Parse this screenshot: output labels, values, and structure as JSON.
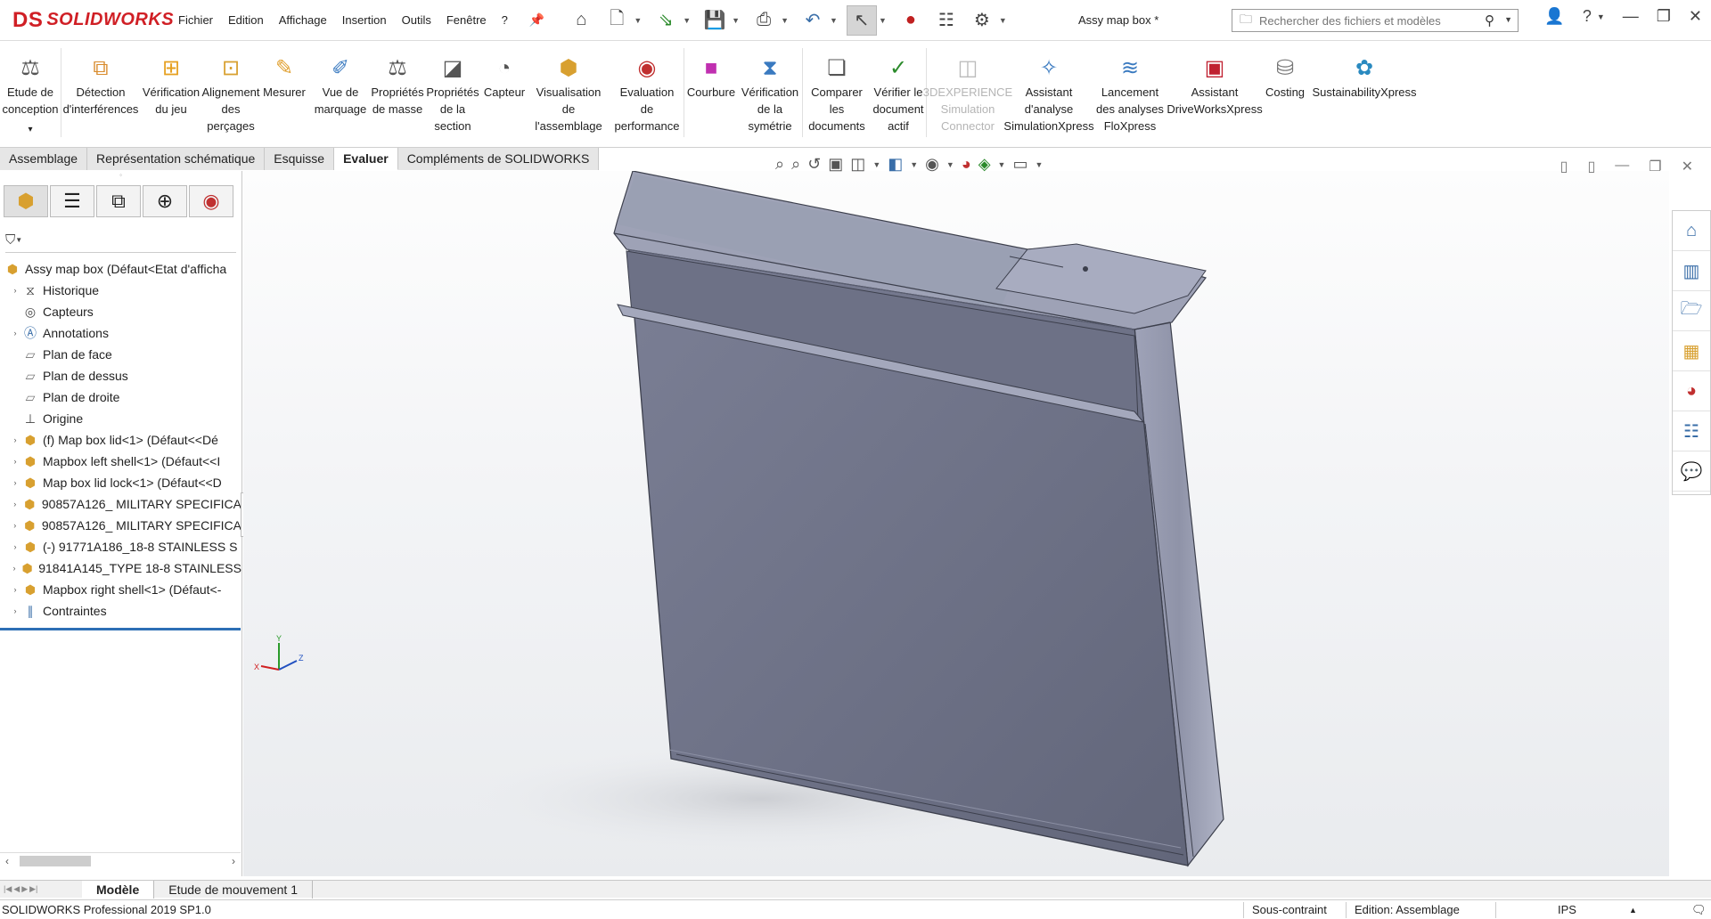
{
  "app": {
    "logo_mark": "DS",
    "logo_text": "SOLIDWORKS",
    "doc_title": "Assy map box *"
  },
  "menu": [
    "Fichier",
    "Edition",
    "Affichage",
    "Insertion",
    "Outils",
    "Fenêtre",
    "?"
  ],
  "search": {
    "placeholder": "Rechercher des fichiers et modèles"
  },
  "ribbon": [
    {
      "label": "Etude de\nconception",
      "icon": "design-study-icon",
      "color": "#555"
    },
    {
      "label": "Détection\nd'interférences",
      "icon": "interference-icon",
      "color": "#d88a2b"
    },
    {
      "label": "Vérification\ndu jeu",
      "icon": "clearance-icon",
      "color": "#e6a020"
    },
    {
      "label": "Alignement\ndes\nperçages",
      "icon": "hole-align-icon",
      "color": "#d8a030"
    },
    {
      "label": "Mesurer",
      "icon": "measure-icon",
      "color": "#e0a030"
    },
    {
      "label": "Vue de\nmarquage",
      "icon": "markup-icon",
      "color": "#3a7ac0"
    },
    {
      "label": "Propriétés\nde masse",
      "icon": "mass-props-icon",
      "color": "#555"
    },
    {
      "label": "Propriétés\nde la\nsection",
      "icon": "section-props-icon",
      "color": "#555"
    },
    {
      "label": "Capteur",
      "icon": "sensor-icon",
      "color": "#555"
    },
    {
      "label": "Visualisation\nde\nl'assemblage",
      "icon": "assembly-vis-icon",
      "color": "#d8a030"
    },
    {
      "label": "Evaluation\nde\nperformance",
      "icon": "performance-icon",
      "color": "#c03030"
    },
    {
      "label": "Courbure",
      "icon": "curvature-icon",
      "color": "#c02fb0"
    },
    {
      "label": "Vérification\nde la\nsymétrie",
      "icon": "symmetry-icon",
      "color": "#3a7ac0"
    },
    {
      "label": "Comparer\nles\ndocuments",
      "icon": "compare-icon",
      "color": "#555"
    },
    {
      "label": "Vérifier le\ndocument\nactif",
      "icon": "check-doc-icon",
      "color": "#2a8a2a"
    },
    {
      "label": "3DEXPERIENCE\nSimulation\nConnector",
      "icon": "3dx-icon",
      "color": "#bbb",
      "disabled": true
    },
    {
      "label": "Assistant\nd'analyse\nSimulationXpress",
      "icon": "simxpress-icon",
      "color": "#3a7ac0"
    },
    {
      "label": "Lancement\ndes analyses\nFloXpress",
      "icon": "floxpress-icon",
      "color": "#3a7ac0"
    },
    {
      "label": "Assistant\nDriveWorksXpress",
      "icon": "driveworks-icon",
      "color": "#c02030"
    },
    {
      "label": "Costing",
      "icon": "costing-icon",
      "color": "#777"
    },
    {
      "label": "SustainabilityXpress",
      "icon": "sustainability-icon",
      "color": "#2a8ac0"
    }
  ],
  "tabs": [
    "Assemblage",
    "Représentation schématique",
    "Esquisse",
    "Evaluer",
    "Compléments de SOLIDWORKS"
  ],
  "tree": {
    "root": "Assy map box  (Défaut<Etat d'afficha",
    "items": [
      {
        "label": "Historique",
        "expand": true,
        "icon": "history-icon"
      },
      {
        "label": "Capteurs",
        "expand": false,
        "icon": "sensors-icon"
      },
      {
        "label": "Annotations",
        "expand": true,
        "icon": "annotations-icon"
      },
      {
        "label": "Plan de face",
        "expand": false,
        "icon": "plane-icon"
      },
      {
        "label": "Plan de dessus",
        "expand": false,
        "icon": "plane-icon"
      },
      {
        "label": "Plan de droite",
        "expand": false,
        "icon": "plane-icon"
      },
      {
        "label": "Origine",
        "expand": false,
        "icon": "origin-icon"
      },
      {
        "label": "(f) Map box lid<1> (Défaut<<Dé",
        "expand": true,
        "icon": "part-icon"
      },
      {
        "label": "Mapbox left shell<1> (Défaut<<I",
        "expand": true,
        "icon": "part-icon"
      },
      {
        "label": "Map box lid lock<1> (Défaut<<D",
        "expand": true,
        "icon": "part-icon"
      },
      {
        "label": "90857A126_ MILITARY SPECIFICA",
        "expand": true,
        "icon": "part-icon"
      },
      {
        "label": "90857A126_ MILITARY SPECIFICA",
        "expand": true,
        "icon": "part-icon"
      },
      {
        "label": "(-) 91771A186_18-8 STAINLESS S",
        "expand": true,
        "icon": "part-icon"
      },
      {
        "label": "91841A145_TYPE 18-8 STAINLESS",
        "expand": true,
        "icon": "part-icon"
      },
      {
        "label": "Mapbox right shell<1> (Défaut<-",
        "expand": true,
        "icon": "part-icon"
      },
      {
        "label": "Contraintes",
        "expand": true,
        "icon": "mates-icon"
      }
    ]
  },
  "bottom_tabs": [
    "Modèle",
    "Etude de mouvement 1"
  ],
  "status": {
    "left": "SOLIDWORKS Professional 2019 SP1.0",
    "constraint": "Sous-contraint",
    "edition": "Edition: Assemblage",
    "units": "IPS"
  },
  "colors": {
    "brand": "#d01f25",
    "model": "#6e7388",
    "accent": "#2d6fb5"
  }
}
